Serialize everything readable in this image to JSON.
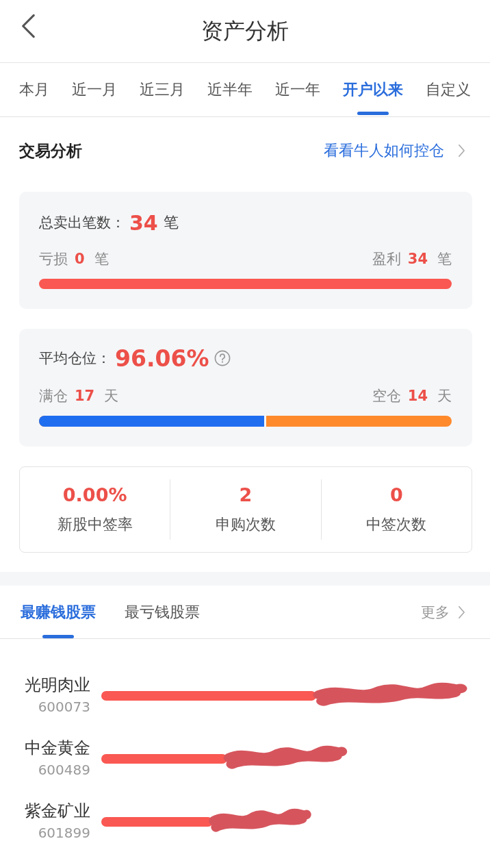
{
  "header": {
    "title": "资产分析"
  },
  "period_tabs": [
    {
      "label": "本月",
      "selected": false
    },
    {
      "label": "近一月",
      "selected": false
    },
    {
      "label": "近三月",
      "selected": false
    },
    {
      "label": "近半年",
      "selected": false
    },
    {
      "label": "近一年",
      "selected": false
    },
    {
      "label": "开户以来",
      "selected": true
    },
    {
      "label": "自定义",
      "selected": false
    }
  ],
  "trade_analysis": {
    "title": "交易分析",
    "link": "看看牛人如何控仓",
    "sell_card": {
      "label": "总卖出笔数：",
      "value": "34",
      "unit": "笔",
      "left": {
        "label": "亏损",
        "value": "0",
        "unit": "笔"
      },
      "right": {
        "label": "盈利",
        "value": "34",
        "unit": "笔"
      },
      "level": 1
    },
    "position_card": {
      "label": "平均仓位：",
      "value": "96.06%",
      "left": {
        "label": "满仓",
        "value": "17",
        "unit": "天"
      },
      "right": {
        "label": "空仓",
        "value": "14",
        "unit": "天"
      },
      "level": 0.55
    }
  },
  "ipo_stats": [
    {
      "value": "0.00%",
      "label": "新股中签率"
    },
    {
      "value": "2",
      "label": "申购次数"
    },
    {
      "value": "0",
      "label": "中签次数"
    }
  ],
  "stock_tabs": [
    {
      "label": "最赚钱股票",
      "selected": true
    },
    {
      "label": "最亏钱股票",
      "selected": false
    }
  ],
  "more_link": "更多",
  "stocks": [
    {
      "name": "光明肉业",
      "code": "600073",
      "redacted": true
    },
    {
      "name": "中金黄金",
      "code": "600489",
      "redacted": true
    },
    {
      "name": "紫金矿业",
      "code": "601899",
      "redacted": true
    }
  ]
}
